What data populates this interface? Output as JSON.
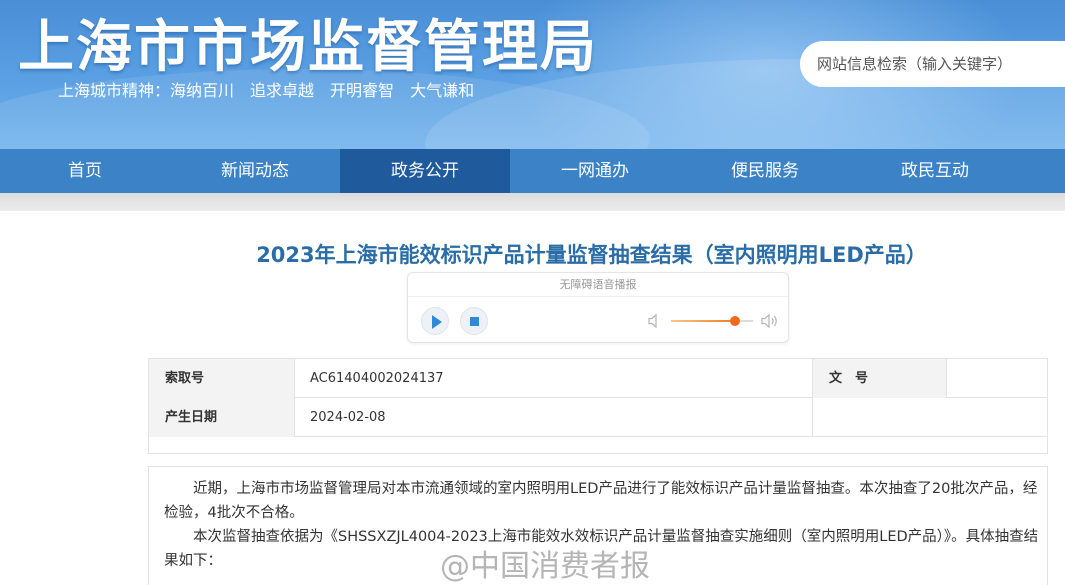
{
  "header": {
    "site_title": "上海市市场监督管理局",
    "spirit_label": "上海城市精神：",
    "spirit_items": [
      "海纳百川",
      "追求卓越",
      "开明睿智",
      "大气谦和"
    ],
    "search_placeholder": "网站信息检索（输入关键字）"
  },
  "nav": {
    "items": [
      {
        "label": "首页"
      },
      {
        "label": "新闻动态"
      },
      {
        "label": "政务公开"
      },
      {
        "label": "一网通办"
      },
      {
        "label": "便民服务"
      },
      {
        "label": "政民互动"
      }
    ],
    "active": "政务公开",
    "active_color": "#1e5a9c",
    "bar_color": "#3b82c6"
  },
  "article": {
    "title": "2023年上海市能效标识产品计量监督抽查结果（室内照明用LED产品）",
    "title_color": "#2a6da6",
    "player": {
      "label": "无障碍语音播报",
      "volume_fraction": 0.78,
      "play_icon": "play-icon",
      "stop_icon": "stop-icon"
    },
    "info": {
      "index_label": "索取号",
      "index_value": "AC61404002024137",
      "doc_label": "文　号",
      "doc_value": "",
      "date_label": "产生日期",
      "date_value": "2024-02-08"
    },
    "paragraphs": [
      "近期，上海市市场监督管理局对本市流通领域的室内照明用LED产品进行了能效标识产品计量监督抽查。本次抽查了20批次产品，经检验，4批次不合格。",
      "本次监督抽查依据为《SHSSXZJL4004-2023上海市能效水效标识产品计量监督抽查实施细则（室内照明用LED产品）》。具体抽查结果如下："
    ]
  },
  "watermark": "@中国消费者报"
}
